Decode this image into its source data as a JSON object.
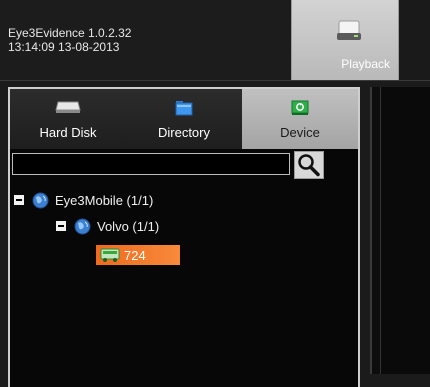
{
  "app": {
    "name_version": "Eye3Evidence 1.0.2.32",
    "datetime": "13:14:09 13-08-2013"
  },
  "toolbar": {
    "playback_label": "Playback",
    "playback_icon": "hard-drive-icon"
  },
  "source_tabs": [
    {
      "label": "Hard Disk",
      "icon": "hard-disk-icon",
      "active": false
    },
    {
      "label": "Directory",
      "icon": "folder-icon",
      "active": false
    },
    {
      "label": "Device",
      "icon": "device-icon",
      "active": true
    }
  ],
  "search": {
    "value": "",
    "placeholder": ""
  },
  "tree": {
    "root": {
      "label": "Eye3Mobile (1/1)"
    },
    "group": {
      "label": "Volvo (1/1)"
    },
    "device": {
      "label": "724"
    }
  },
  "colors": {
    "selected_device_bg": "#f06a1e",
    "active_tab_bg": "#b4b4b4",
    "globe_blue": "#3d7fd1",
    "device_icon_green": "#4caf50"
  }
}
